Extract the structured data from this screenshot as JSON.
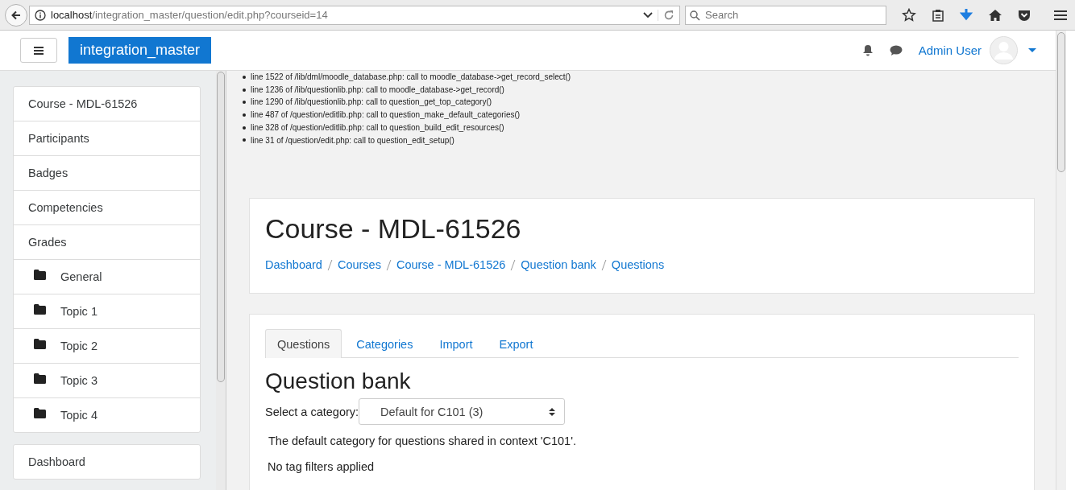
{
  "browser": {
    "url_host": "localhost",
    "url_path": "/integration_master/question/edit.php?courseid=14",
    "search": {
      "placeholder": "Search"
    }
  },
  "navbar": {
    "site_name": "integration_master",
    "user_name": "Admin User"
  },
  "sidebar": {
    "groups": [
      {
        "items": [
          {
            "label": "Course - MDL-61526",
            "kind": "link"
          },
          {
            "label": "Participants",
            "kind": "link"
          },
          {
            "label": "Badges",
            "kind": "link"
          },
          {
            "label": "Competencies",
            "kind": "link"
          },
          {
            "label": "Grades",
            "kind": "link"
          },
          {
            "label": "General",
            "kind": "section"
          },
          {
            "label": "Topic 1",
            "kind": "section"
          },
          {
            "label": "Topic 2",
            "kind": "section"
          },
          {
            "label": "Topic 3",
            "kind": "section"
          },
          {
            "label": "Topic 4",
            "kind": "section"
          }
        ]
      },
      {
        "items": [
          {
            "label": "Dashboard",
            "kind": "link"
          }
        ]
      }
    ]
  },
  "debug_trace": [
    "line 1522 of /lib/dml/moodle_database.php: call to moodle_database->get_record_select()",
    "line 1236 of /lib/questionlib.php: call to moodle_database->get_record()",
    "line 1290 of /lib/questionlib.php: call to question_get_top_category()",
    "line 487 of /question/editlib.php: call to question_make_default_categories()",
    "line 328 of /question/editlib.php: call to question_build_edit_resources()",
    "line 31 of /question/edit.php: call to question_edit_setup()"
  ],
  "header": {
    "title": "Course - MDL-61526",
    "breadcrumbs": [
      "Dashboard",
      "Courses",
      "Course - MDL-61526",
      "Question bank",
      "Questions"
    ]
  },
  "tabs": [
    {
      "label": "Questions",
      "selected": true
    },
    {
      "label": "Categories",
      "selected": false
    },
    {
      "label": "Import",
      "selected": false
    },
    {
      "label": "Export",
      "selected": false
    }
  ],
  "question_bank": {
    "title": "Question bank",
    "category_label": "Select a category:",
    "category_value": "Default for C101 (3)",
    "category_info": "The default category for questions shared in context 'C101'.",
    "tag_filters": "No tag filters applied"
  }
}
